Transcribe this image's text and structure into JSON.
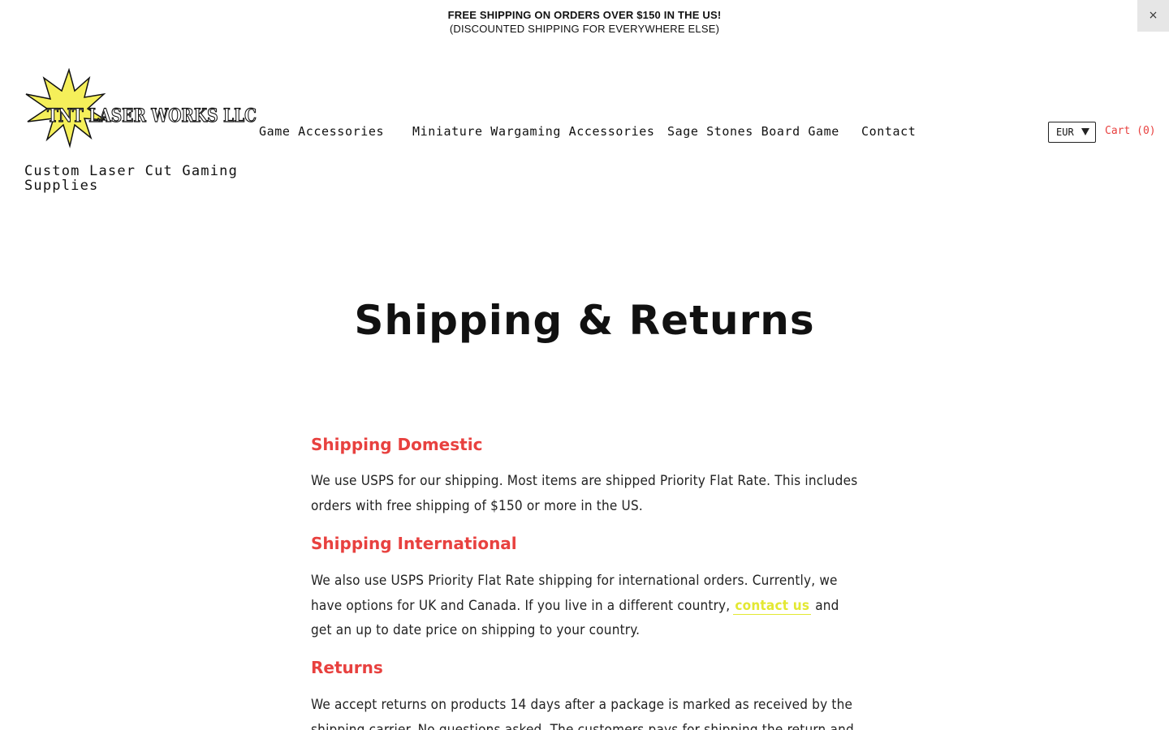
{
  "announcement": {
    "line1": "FREE SHIPPING ON ORDERS OVER $150 IN THE US!",
    "line2": "(DISCOUNTED SHIPPING FOR EVERYWHERE ELSE)",
    "close_label": "×"
  },
  "brand": {
    "logo_text": "TNT LASER WORKS LLC",
    "tagline": "Custom Laser Cut Gaming Supplies",
    "logo_star_color": "#f5ef5a"
  },
  "nav": {
    "items": [
      {
        "label": "Game Accessories"
      },
      {
        "label": "Miniature Wargaming Accessories"
      },
      {
        "label": "Sage Stones Board Game"
      },
      {
        "label": "Contact"
      }
    ]
  },
  "header": {
    "currency": "EUR",
    "cart_label": "Cart (0)"
  },
  "page": {
    "title": "Shipping & Returns",
    "sections": [
      {
        "heading": "Shipping Domestic",
        "text": "We use USPS for our shipping. Most items are shipped Priority Flat Rate. This includes orders with free shipping of $150 or more in the US."
      },
      {
        "heading": "Shipping International",
        "text_before": "We also use USPS Priority Flat Rate shipping for international orders. Currently, we have options for UK and Canada. If you live in a different country,",
        "link": "contact us",
        "text_after": " and get an up to date price on shipping to your country."
      },
      {
        "heading": "Returns",
        "text": "We accept returns on products 14 days after a package is marked as received by the shipping carrier. No questions asked. The customers pays for shipping the return and"
      }
    ]
  },
  "colors": {
    "accent": "#e8413f",
    "link": "#e3e832",
    "text": "#111111"
  }
}
